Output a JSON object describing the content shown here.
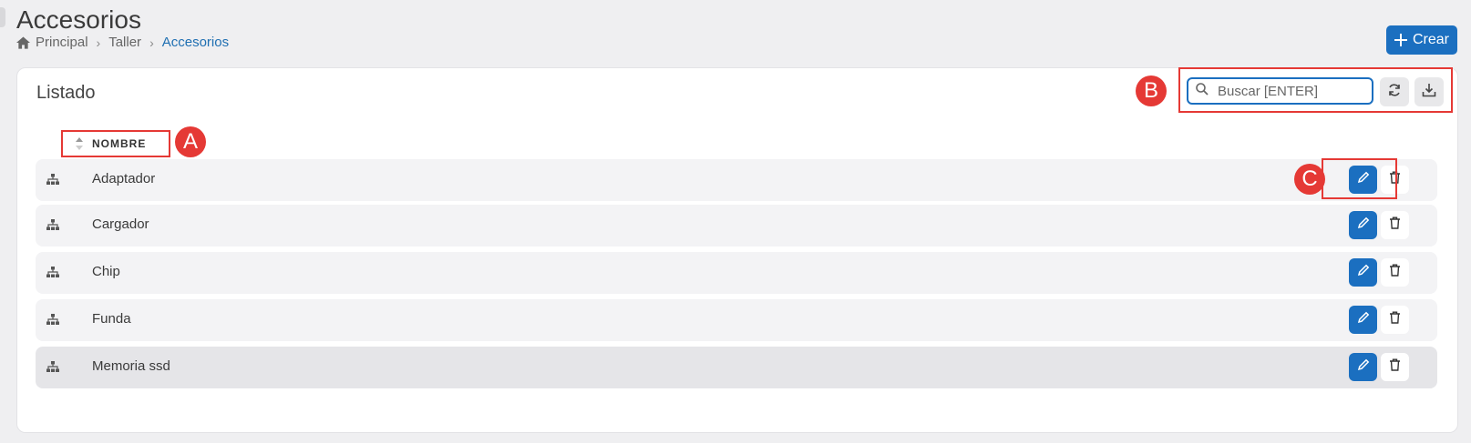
{
  "header": {
    "title": "Accesorios",
    "breadcrumb": [
      "Principal",
      "Taller",
      "Accesorios"
    ],
    "create_label": "Crear"
  },
  "card": {
    "title": "Listado",
    "search_placeholder": "Buscar [ENTER]",
    "column_header": "NOMBRE"
  },
  "markers": {
    "a": "A",
    "b": "B",
    "c": "C"
  },
  "rows": [
    {
      "label": "Adaptador"
    },
    {
      "label": "Cargador"
    },
    {
      "label": "Chip"
    },
    {
      "label": "Funda"
    },
    {
      "label": "Memoria ssd"
    }
  ],
  "icons": {
    "home": "home-icon",
    "plus": "plus-icon",
    "search": "search-icon",
    "refresh": "refresh-icon",
    "download": "download-icon",
    "sitemap": "sitemap-icon",
    "edit": "pencil-icon",
    "delete": "trash-icon",
    "sort": "sort-icon"
  },
  "colors": {
    "accent": "#1b6fc0",
    "annotation": "#e53935"
  }
}
